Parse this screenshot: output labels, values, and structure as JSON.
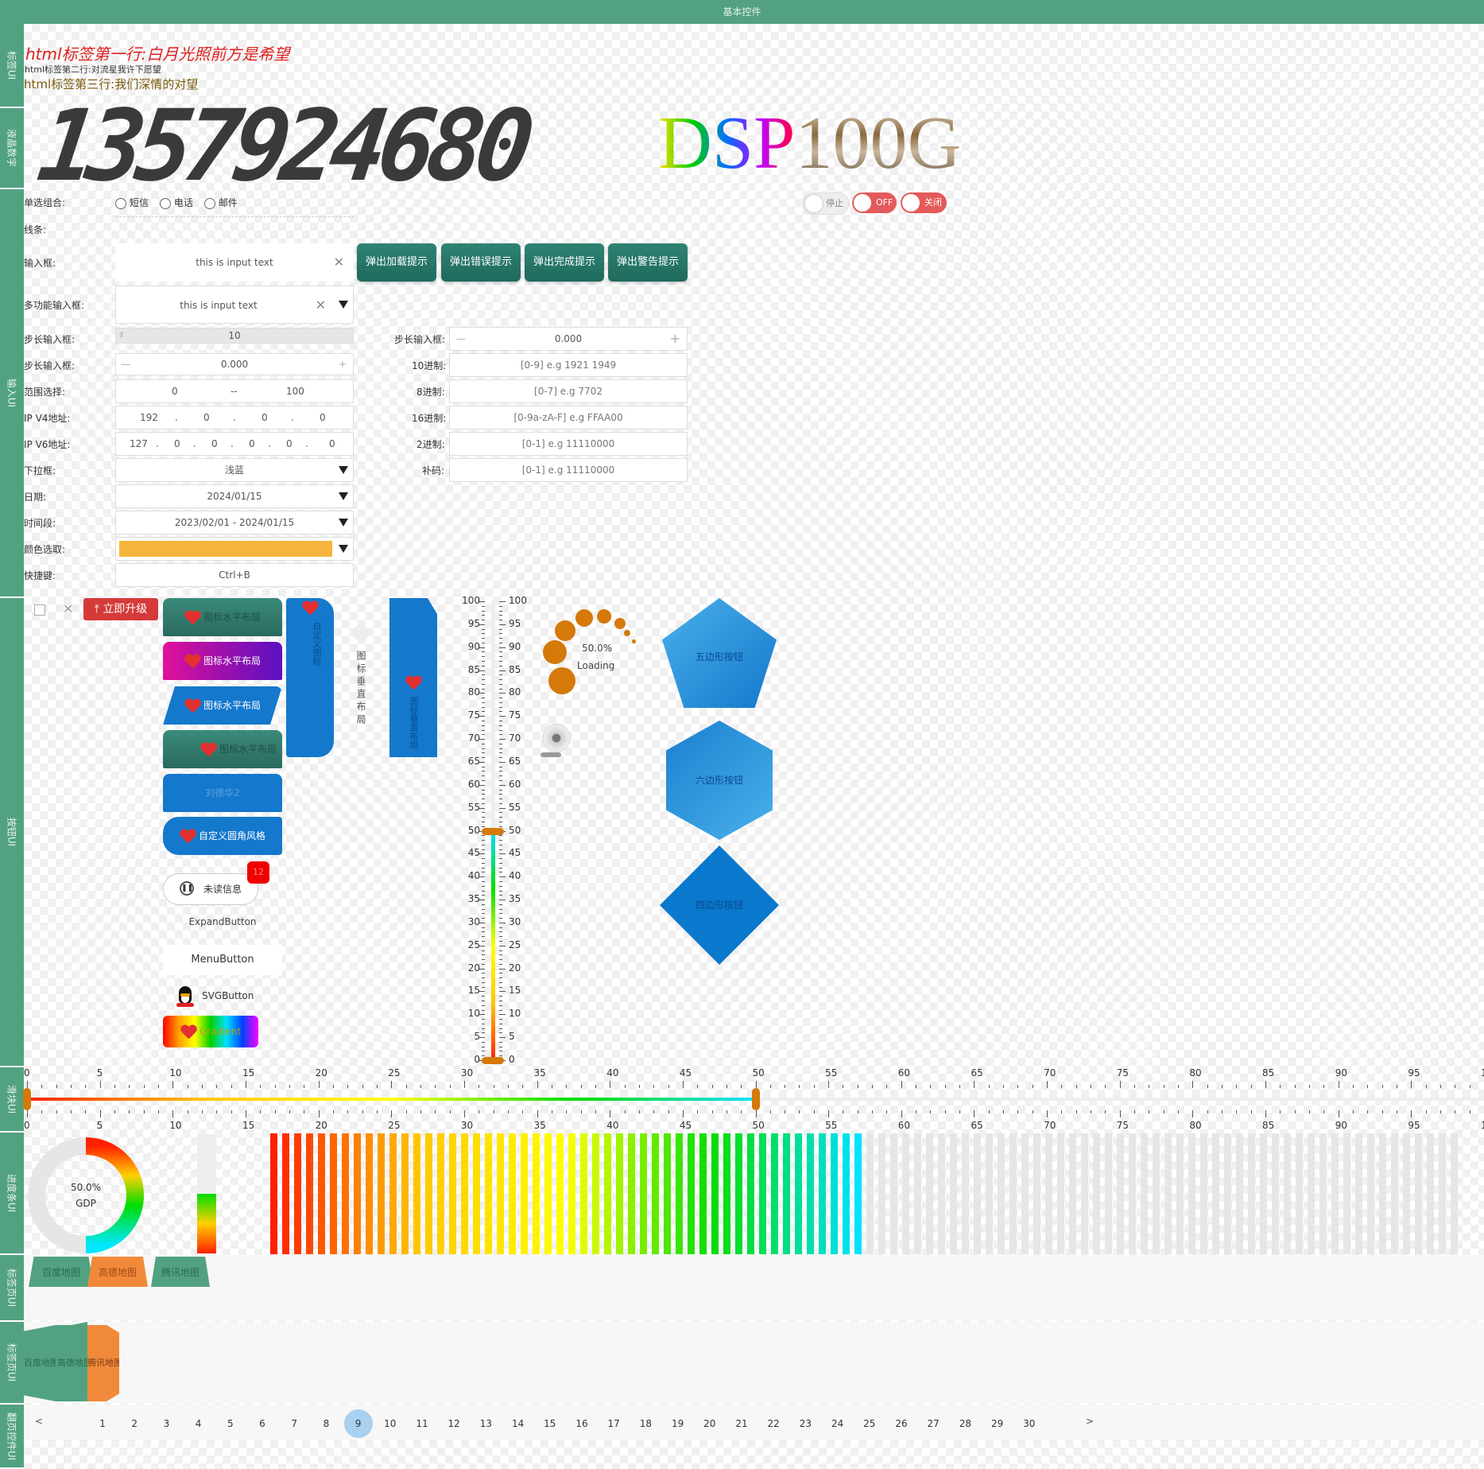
{
  "window": {
    "title": "基本控件"
  },
  "sidebar": {
    "tabs": [
      "标签UI",
      "液晶数字",
      "输入UI",
      "按钮UI",
      "滑块UI",
      "进度条UI",
      "标签页UI",
      "标签页UI",
      "翻页控件UI"
    ]
  },
  "html_label": {
    "line1": "html标签第一行:白月光照前方是希望",
    "line2": "html标签第二行:对流星我许下愿望",
    "line3": "html标签第三行:我们深情的对望"
  },
  "lcd": {
    "value": "1357924680"
  },
  "dsp": {
    "part1": "DSP",
    "part2": "100G"
  },
  "toggles": {
    "stop": "停止",
    "off": "OFF",
    "close": "关闭"
  },
  "form": {
    "radio_label": "单选组合:",
    "radio_options": [
      "短信",
      "电话",
      "邮件"
    ],
    "line_label": "线条:",
    "input_label": "输入框:",
    "input_value": "this is input text",
    "multi_label": "多功能输入框:",
    "multi_value": "this is input text",
    "step_label1": "步长输入框:",
    "step_value1": "10",
    "step_label2": "步长输入框:",
    "step_value2": "0.000",
    "step_label3": "步长输入框:",
    "step_value3": "0.000",
    "range_label": "范围选择:",
    "range_min": "0",
    "range_sep": "--",
    "range_max": "100",
    "ipv4_label": "IP V4地址:",
    "ipv4": [
      "192",
      "0",
      "0",
      "0"
    ],
    "ipv6_label": "IP V6地址:",
    "ipv6": [
      "127",
      "0",
      "0",
      "0",
      "0",
      "0",
      "0"
    ],
    "dropdown_label": "下拉框:",
    "dropdown_value": "浅蓝",
    "date_label": "日期:",
    "date_value": "2024/01/15",
    "period_label": "时间段:",
    "period_value": "2023/02/01 - 2024/01/15",
    "color_label": "颜色选取:",
    "color_value": "#f5b43c",
    "hotkey_label": "快捷键:",
    "hotkey_value": "Ctrl+B",
    "dec_label": "10进制:",
    "dec_placeholder": "[0-9] e.g 1921 1949",
    "oct_label": "8进制:",
    "oct_placeholder": "[0-7] e.g 7702",
    "hex_label": "16进制:",
    "hex_placeholder": "[0-9a-zA-F] e.g FFAA00",
    "bin_label": "2进制:",
    "bin_placeholder": "[0-1] e.g 11110000",
    "comp_label": "补码:",
    "comp_placeholder": "[0-1] e.g 11110000"
  },
  "popup_buttons": [
    "弹出加载提示",
    "弹出错误提示",
    "弹出完成提示",
    "弹出警告提示"
  ],
  "buttons": {
    "upgrade": "立即升级",
    "h1": "图标水平布局",
    "h2": "图标水平布局",
    "h3": "图标水平布局",
    "h4": "图标水平布局",
    "liu": "刘德华2",
    "round": "自定义圆角风格",
    "unread": "未读信息",
    "unread_count": "12",
    "expand": "ExpandButton",
    "menu": "MenuButton",
    "svg": "SVGButton",
    "gradient": "Gradient",
    "custom_icon": "自定义图标",
    "vert1": "图标垂直布局",
    "vert2": "图标垂直布局",
    "pentagon": "五边形按钮",
    "hexagon": "六边形按钮",
    "diamond": "四边形按钮",
    "loading_pct": "50.0%",
    "loading_text": "Loading"
  },
  "vslider": {
    "value": 50,
    "min": 0,
    "max": 100,
    "ticks": [
      "100",
      "95",
      "90",
      "85",
      "80",
      "75",
      "70",
      "65",
      "60",
      "55",
      "50",
      "45",
      "40",
      "35",
      "30",
      "25",
      "20",
      "15",
      "10",
      "5",
      "0"
    ]
  },
  "hslider": {
    "value": 50,
    "min": 0,
    "max": 100,
    "ticks": [
      "0",
      "5",
      "10",
      "15",
      "20",
      "25",
      "30",
      "35",
      "40",
      "45",
      "50",
      "55",
      "60",
      "65",
      "70",
      "75",
      "80",
      "85",
      "90",
      "95",
      "100"
    ]
  },
  "progress": {
    "ring_pct": "50.0%",
    "ring_label": "GDP",
    "ring_value": 50,
    "vbar_value": 50,
    "seg_value": 50
  },
  "tabs1": [
    "百度地图",
    "高德地图",
    "腾讯地图"
  ],
  "tabs2": [
    "百度地图",
    "高德地图",
    "腾讯地图"
  ],
  "pagination": {
    "prev": "<",
    "next": ">",
    "pages": [
      "1",
      "2",
      "3",
      "4",
      "5",
      "6",
      "7",
      "8",
      "9",
      "10",
      "11",
      "12",
      "13",
      "14",
      "15",
      "16",
      "17",
      "18",
      "19",
      "20",
      "21",
      "22",
      "23",
      "24",
      "25",
      "26",
      "27",
      "28",
      "29",
      "30"
    ],
    "current": "9"
  },
  "colors": {
    "accent": "#52a281",
    "teal_button": "#2a7a6a",
    "blue_button": "#1478cc",
    "upgrade": "#d53a3a",
    "toggle_red": "#e45a5a",
    "loading": "#d4790a"
  }
}
